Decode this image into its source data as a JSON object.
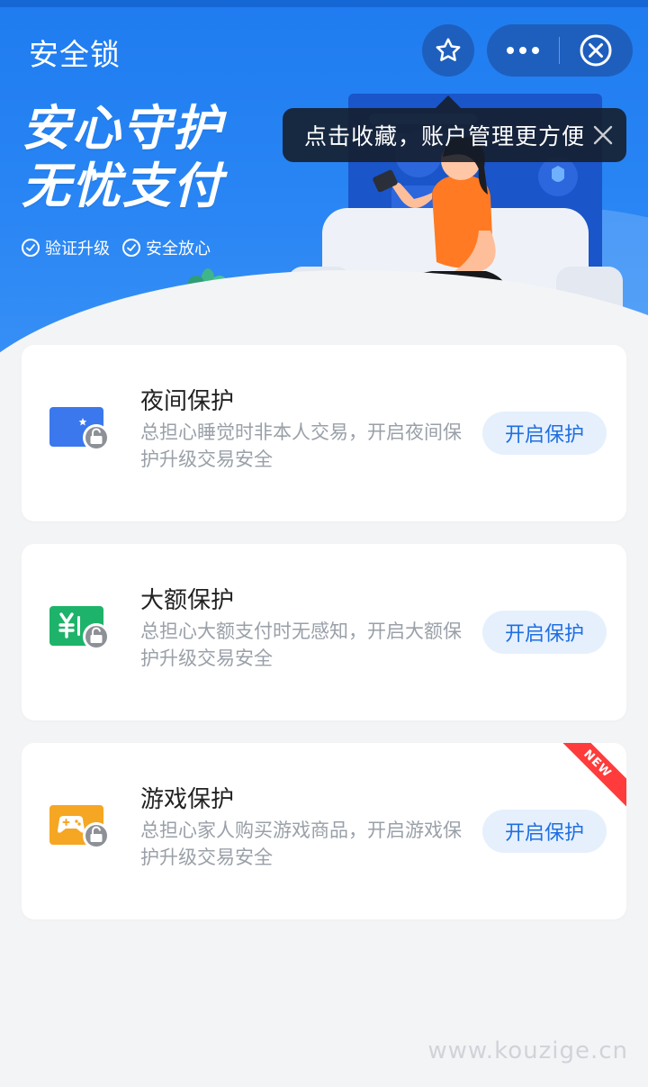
{
  "nav": {
    "title": "安全锁"
  },
  "tooltip": {
    "text": "点击收藏，账户管理更方便"
  },
  "hero": {
    "slogan_line1": "安心守护",
    "slogan_line2": "无忧支付",
    "badges": [
      "验证升级",
      "安全放心"
    ]
  },
  "cards": [
    {
      "title": "夜间保护",
      "desc": "总担心睡觉时非本人交易，开启夜间保护升级交易安全",
      "button": "开启保护",
      "icon": "night-lock-icon",
      "icon_color": "#3b78ee"
    },
    {
      "title": "大额保护",
      "desc": "总担心大额支付时无感知，开启大额保护升级交易安全",
      "button": "开启保护",
      "icon": "yuan-lock-icon",
      "icon_color": "#1eb36a"
    },
    {
      "title": "游戏保护",
      "desc": "总担心家人购买游戏商品，开启游戏保护升级交易安全",
      "button": "开启保护",
      "icon": "gamepad-lock-icon",
      "icon_color": "#f5a623",
      "ribbon": "NEW"
    }
  ],
  "watermark": "www.kouzige.cn",
  "colors": {
    "primary_blue": "#2a86f4",
    "button_text": "#1f6fe0",
    "button_bg": "#e6f0fd",
    "ribbon": "#ff3b3b"
  }
}
